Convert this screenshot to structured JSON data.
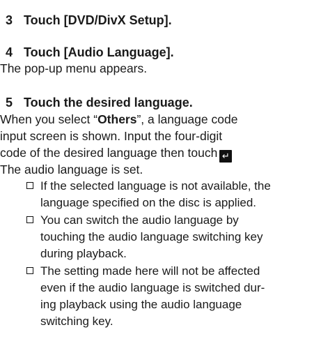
{
  "steps": [
    {
      "num": "3",
      "title": "Touch [DVD/DivX Setup]."
    },
    {
      "num": "4",
      "title": "Touch [Audio Language]."
    },
    {
      "num": "5",
      "title": "Touch the desired language."
    }
  ],
  "step4_note": "The pop-up menu appears.",
  "step5_body": {
    "line1_pre": "When you select “",
    "line1_bold": "Others",
    "line1_post": "”, a language code",
    "line2": "input screen is shown. Input the four-digit",
    "line3": "code of the desired language then touch",
    "enter_key_glyph": "↵",
    "line4": "The audio language is set."
  },
  "bullets": [
    {
      "lines": [
        "If the selected language is not available, the",
        "language specified on the disc is applied."
      ]
    },
    {
      "lines": [
        "You can switch the audio language by",
        "touching the audio language switching key",
        "during playback."
      ]
    },
    {
      "lines": [
        "The setting made here will not be affected",
        "even if the audio language is switched dur-",
        "ing playback using the audio language",
        "switching key."
      ]
    }
  ]
}
